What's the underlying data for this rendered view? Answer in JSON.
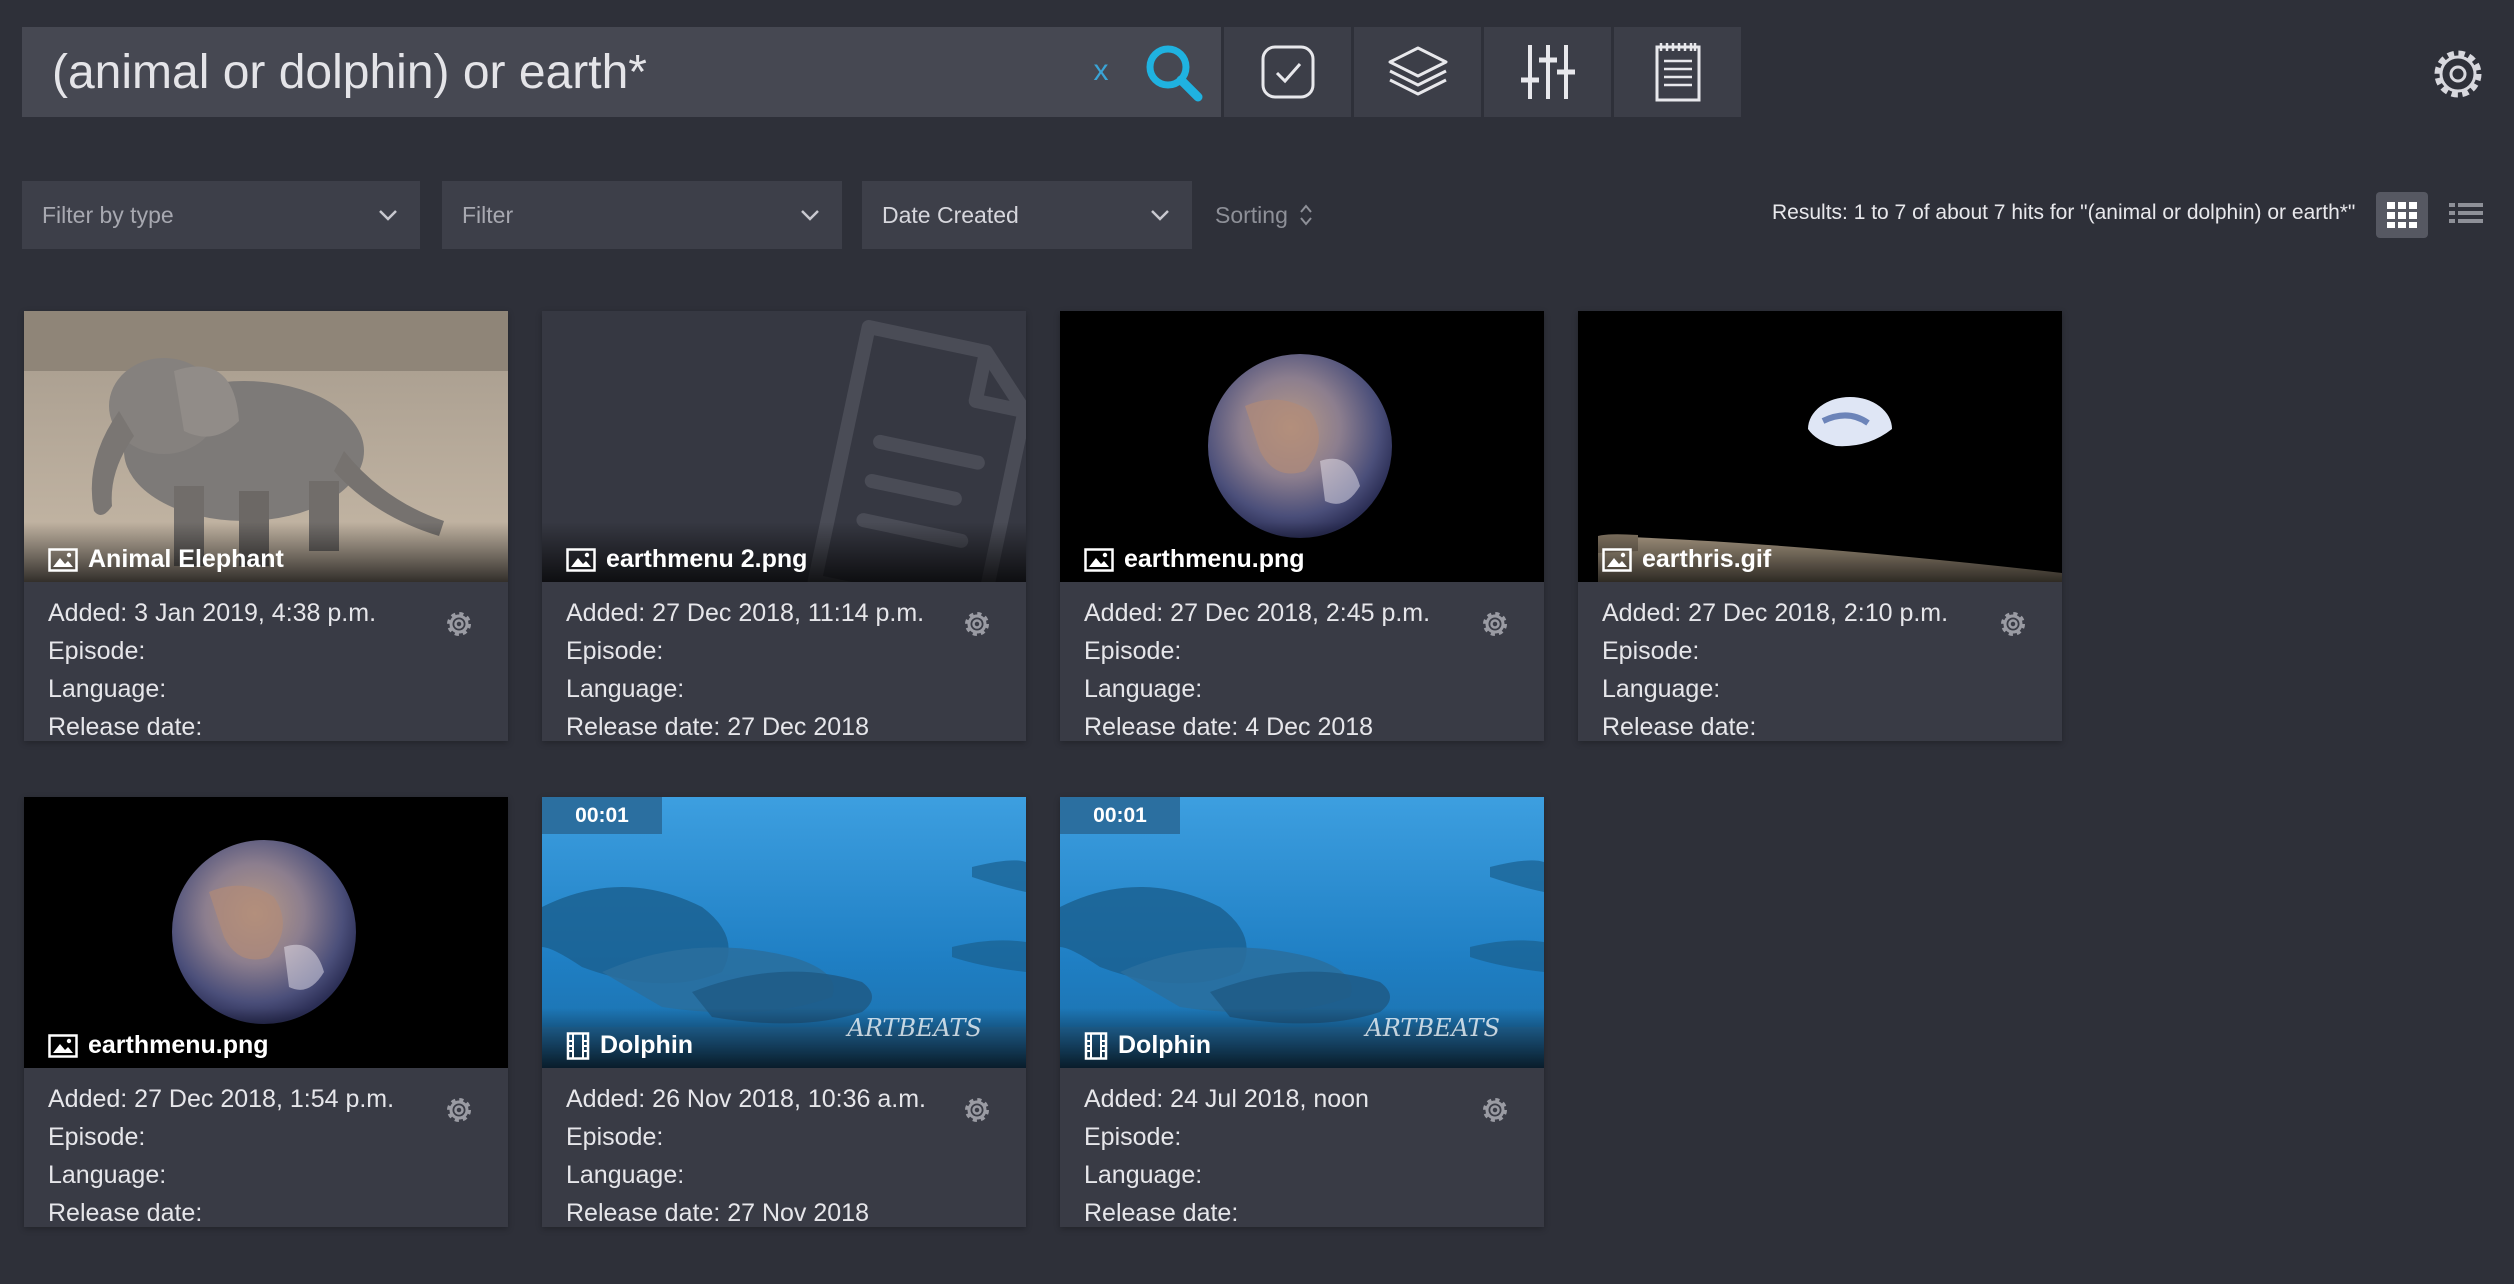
{
  "search": {
    "query": "(animal or dolphin) or earth*",
    "clear_label": "x"
  },
  "toolbar": {
    "icons": [
      "search-icon",
      "check-square-icon",
      "layers-icon",
      "sliders-icon",
      "notepad-icon",
      "gear-icon"
    ]
  },
  "filters": {
    "type_placeholder": "Filter by type",
    "filter_placeholder": "Filter",
    "sort_field": "Date Created",
    "sorting_label": "Sorting"
  },
  "results_text": "Results: 1 to 7 of about 7 hits for \"(animal or dolphin) or earth*\"",
  "colors": {
    "accent": "#3aa4d6",
    "background": "#2e3039",
    "card": "#393b45",
    "duration_badge": "#2b6fa0"
  },
  "cards": [
    {
      "title": "Animal Elephant",
      "kind": "image",
      "duration": "",
      "added": "Added: 3 Jan 2019, 4:38 p.m.",
      "episode": "Episode:",
      "language": "Language:",
      "release": "Release date:"
    },
    {
      "title": "earthmenu 2.png",
      "kind": "image",
      "duration": "",
      "added": "Added: 27 Dec 2018, 11:14 p.m.",
      "episode": "Episode:",
      "language": "Language:",
      "release": "Release date: 27 Dec 2018"
    },
    {
      "title": "earthmenu.png",
      "kind": "image",
      "duration": "",
      "added": "Added: 27 Dec 2018, 2:45 p.m.",
      "episode": "Episode:",
      "language": "Language:",
      "release": "Release date: 4 Dec 2018"
    },
    {
      "title": "earthris.gif",
      "kind": "image",
      "duration": "",
      "added": "Added: 27 Dec 2018, 2:10 p.m.",
      "episode": "Episode:",
      "language": "Language:",
      "release": "Release date:"
    },
    {
      "title": "earthmenu.png",
      "kind": "image",
      "duration": "",
      "added": "Added: 27 Dec 2018, 1:54 p.m.",
      "episode": "Episode:",
      "language": "Language:",
      "release": "Release date:"
    },
    {
      "title": "Dolphin",
      "kind": "video",
      "duration": "00:01",
      "watermark": "ARTBEATS",
      "added": "Added: 26 Nov 2018, 10:36 a.m.",
      "episode": "Episode:",
      "language": "Language:",
      "release": "Release date: 27 Nov 2018"
    },
    {
      "title": "Dolphin",
      "kind": "video",
      "duration": "00:01",
      "watermark": "ARTBEATS",
      "added": "Added: 24 Jul 2018, noon",
      "episode": "Episode:",
      "language": "Language:",
      "release": "Release date:"
    }
  ]
}
